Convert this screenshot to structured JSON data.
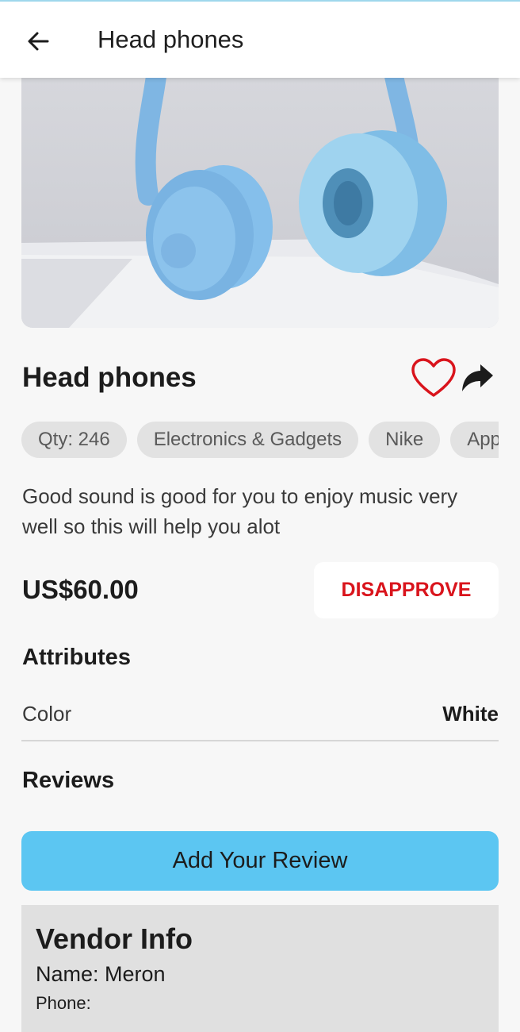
{
  "app_bar": {
    "title": "Head phones",
    "back_icon": "arrow-left-icon"
  },
  "product": {
    "name": "Head phones",
    "chips": [
      "Qty: 246",
      "Electronics & Gadgets",
      "Nike",
      "App"
    ],
    "description": "Good sound is good for you to enjoy music very well so this will help you alot",
    "price": "US$60.00",
    "disapprove_label": "DISAPPROVE",
    "favorite_icon": "heart-outline-icon",
    "share_icon": "share-arrow-icon"
  },
  "attributes": {
    "title": "Attributes",
    "items": [
      {
        "label": "Color",
        "value": "White"
      }
    ]
  },
  "reviews": {
    "title": "Reviews",
    "add_label": "Add Your Review"
  },
  "vendor": {
    "title": "Vendor Info",
    "name_line": "Name: Meron",
    "phone_line": "Phone:"
  },
  "colors": {
    "accent": "#5cc6f2",
    "danger": "#d9141c",
    "background": "#f7f7f7"
  }
}
